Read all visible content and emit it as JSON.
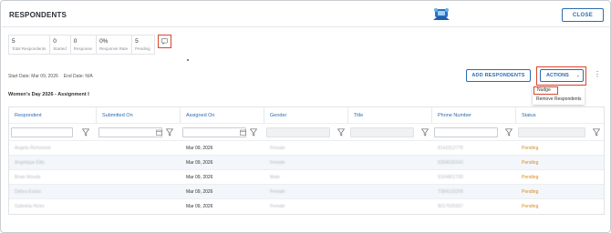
{
  "header": {
    "title": "RESPONDENTS",
    "close_label": "CLOSE"
  },
  "stats": [
    {
      "value": "5",
      "label": "Total Respondents"
    },
    {
      "value": "0",
      "label": "Started"
    },
    {
      "value": "0",
      "label": "Response"
    },
    {
      "value": "0%",
      "label": "Response Rate"
    },
    {
      "value": "5",
      "label": "Pending"
    }
  ],
  "dates": {
    "start": "Start Date: Mar 09, 2026",
    "end": "End Date: N/A"
  },
  "toolbar": {
    "add_label": "ADD RESPONDENTS",
    "actions_label": "ACTIONS"
  },
  "actions_menu": {
    "nudge": "Nudge",
    "remove": "Remove Respondents"
  },
  "section_title": "Women's Day 2026 - Assignment I",
  "table": {
    "columns": [
      "Respondent",
      "Submitted On",
      "Assigned On",
      "Gender",
      "Title",
      "Phone Number",
      "Status"
    ],
    "rows": [
      {
        "respondent": "Angela Richmond",
        "submitted": "",
        "assigned": "Mar 09, 2026",
        "gender": "Female",
        "title": "",
        "phone": "8143312778",
        "status": "Pending"
      },
      {
        "respondent": "Angelique Ellis",
        "submitted": "",
        "assigned": "Mar 09, 2026",
        "gender": "Female",
        "title": "",
        "phone": "6358030343",
        "status": "Pending"
      },
      {
        "respondent": "Brian Woods",
        "submitted": "",
        "assigned": "Mar 09, 2026",
        "gender": "Male",
        "title": "",
        "phone": "9164801700",
        "status": "Pending"
      },
      {
        "respondent": "Debra Evans",
        "submitted": "",
        "assigned": "Mar 09, 2026",
        "gender": "Female",
        "title": "",
        "phone": "7384133209",
        "status": "Pending"
      },
      {
        "respondent": "Gabriela Hicks",
        "submitted": "",
        "assigned": "Mar 09, 2026",
        "gender": "Female",
        "title": "",
        "phone": "8017025937",
        "status": "Pending"
      }
    ]
  },
  "colors": {
    "accent": "#2b6cb0",
    "highlight": "#d9472b",
    "pending": "#d88b1a"
  }
}
